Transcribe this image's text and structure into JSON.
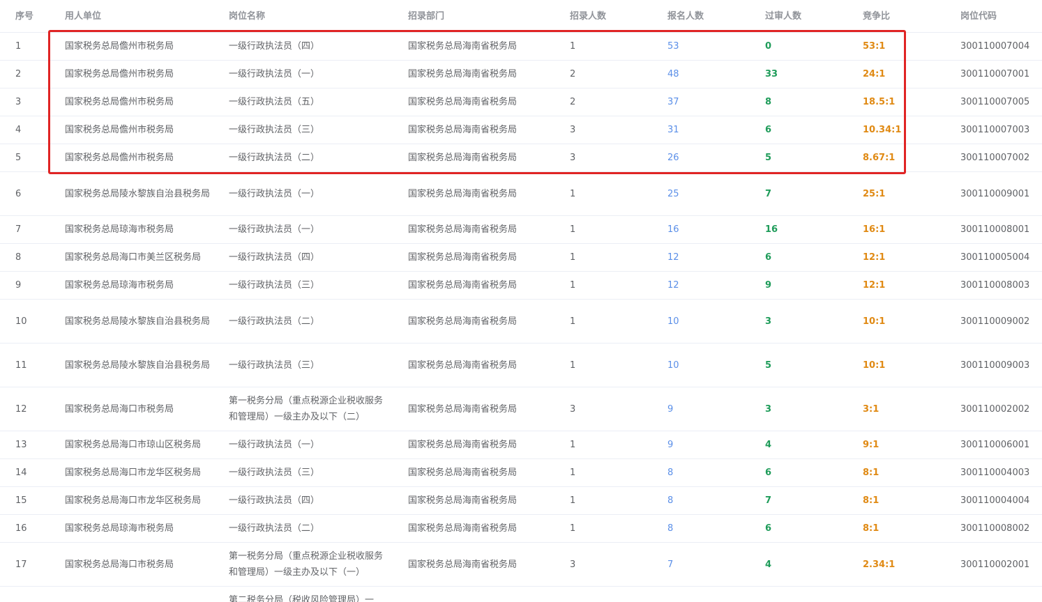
{
  "table": {
    "headers": {
      "index": "序号",
      "unit": "用人单位",
      "position": "岗位名称",
      "department": "招录部门",
      "recruit": "招录人数",
      "applicants": "报名人数",
      "passed": "过审人数",
      "ratio": "竞争比",
      "code": "岗位代码"
    },
    "rows": [
      {
        "index": "1",
        "unit": "国家税务总局儋州市税务局",
        "position": "一级行政执法员（四）",
        "department": "国家税务总局海南省税务局",
        "recruit": "1",
        "applicants": "53",
        "passed": "0",
        "ratio": "53:1",
        "code": "300110007004"
      },
      {
        "index": "2",
        "unit": "国家税务总局儋州市税务局",
        "position": "一级行政执法员（一）",
        "department": "国家税务总局海南省税务局",
        "recruit": "2",
        "applicants": "48",
        "passed": "33",
        "ratio": "24:1",
        "code": "300110007001"
      },
      {
        "index": "3",
        "unit": "国家税务总局儋州市税务局",
        "position": "一级行政执法员（五）",
        "department": "国家税务总局海南省税务局",
        "recruit": "2",
        "applicants": "37",
        "passed": "8",
        "ratio": "18.5:1",
        "code": "300110007005"
      },
      {
        "index": "4",
        "unit": "国家税务总局儋州市税务局",
        "position": "一级行政执法员（三）",
        "department": "国家税务总局海南省税务局",
        "recruit": "3",
        "applicants": "31",
        "passed": "6",
        "ratio": "10.34:1",
        "code": "300110007003"
      },
      {
        "index": "5",
        "unit": "国家税务总局儋州市税务局",
        "position": "一级行政执法员（二）",
        "department": "国家税务总局海南省税务局",
        "recruit": "3",
        "applicants": "26",
        "passed": "5",
        "ratio": "8.67:1",
        "code": "300110007002"
      },
      {
        "index": "6",
        "unit": "国家税务总局陵水黎族自治县税务局",
        "position": "一级行政执法员（一）",
        "department": "国家税务总局海南省税务局",
        "recruit": "1",
        "applicants": "25",
        "passed": "7",
        "ratio": "25:1",
        "code": "300110009001"
      },
      {
        "index": "7",
        "unit": "国家税务总局琼海市税务局",
        "position": "一级行政执法员（一）",
        "department": "国家税务总局海南省税务局",
        "recruit": "1",
        "applicants": "16",
        "passed": "16",
        "ratio": "16:1",
        "code": "300110008001"
      },
      {
        "index": "8",
        "unit": "国家税务总局海口市美兰区税务局",
        "position": "一级行政执法员（四）",
        "department": "国家税务总局海南省税务局",
        "recruit": "1",
        "applicants": "12",
        "passed": "6",
        "ratio": "12:1",
        "code": "300110005004"
      },
      {
        "index": "9",
        "unit": "国家税务总局琼海市税务局",
        "position": "一级行政执法员（三）",
        "department": "国家税务总局海南省税务局",
        "recruit": "1",
        "applicants": "12",
        "passed": "9",
        "ratio": "12:1",
        "code": "300110008003"
      },
      {
        "index": "10",
        "unit": "国家税务总局陵水黎族自治县税务局",
        "position": "一级行政执法员（二）",
        "department": "国家税务总局海南省税务局",
        "recruit": "1",
        "applicants": "10",
        "passed": "3",
        "ratio": "10:1",
        "code": "300110009002"
      },
      {
        "index": "11",
        "unit": "国家税务总局陵水黎族自治县税务局",
        "position": "一级行政执法员（三）",
        "department": "国家税务总局海南省税务局",
        "recruit": "1",
        "applicants": "10",
        "passed": "5",
        "ratio": "10:1",
        "code": "300110009003"
      },
      {
        "index": "12",
        "unit": "国家税务总局海口市税务局",
        "position": "第一税务分局（重点税源企业税收服务和管理局）一级主办及以下（二）",
        "department": "国家税务总局海南省税务局",
        "recruit": "3",
        "applicants": "9",
        "passed": "3",
        "ratio": "3:1",
        "code": "300110002002"
      },
      {
        "index": "13",
        "unit": "国家税务总局海口市琼山区税务局",
        "position": "一级行政执法员（一）",
        "department": "国家税务总局海南省税务局",
        "recruit": "1",
        "applicants": "9",
        "passed": "4",
        "ratio": "9:1",
        "code": "300110006001"
      },
      {
        "index": "14",
        "unit": "国家税务总局海口市龙华区税务局",
        "position": "一级行政执法员（三）",
        "department": "国家税务总局海南省税务局",
        "recruit": "1",
        "applicants": "8",
        "passed": "6",
        "ratio": "8:1",
        "code": "300110004003"
      },
      {
        "index": "15",
        "unit": "国家税务总局海口市龙华区税务局",
        "position": "一级行政执法员（四）",
        "department": "国家税务总局海南省税务局",
        "recruit": "1",
        "applicants": "8",
        "passed": "7",
        "ratio": "8:1",
        "code": "300110004004"
      },
      {
        "index": "16",
        "unit": "国家税务总局琼海市税务局",
        "position": "一级行政执法员（二）",
        "department": "国家税务总局海南省税务局",
        "recruit": "1",
        "applicants": "8",
        "passed": "6",
        "ratio": "8:1",
        "code": "300110008002"
      },
      {
        "index": "17",
        "unit": "国家税务总局海口市税务局",
        "position": "第一税务分局（重点税源企业税收服务和管理局）一级主办及以下（一）",
        "department": "国家税务总局海南省税务局",
        "recruit": "3",
        "applicants": "7",
        "passed": "4",
        "ratio": "2.34:1",
        "code": "300110002001"
      },
      {
        "index": "",
        "unit": "",
        "position": "第二税务分局（税收风险管理局）一",
        "department": "",
        "recruit": "",
        "applicants": "",
        "passed": "",
        "ratio": "",
        "code": ""
      }
    ]
  },
  "colors": {
    "applicants": "#5b8fe8",
    "passed": "#1f9c5a",
    "ratio": "#e08a14",
    "highlight_border": "#e02424"
  }
}
